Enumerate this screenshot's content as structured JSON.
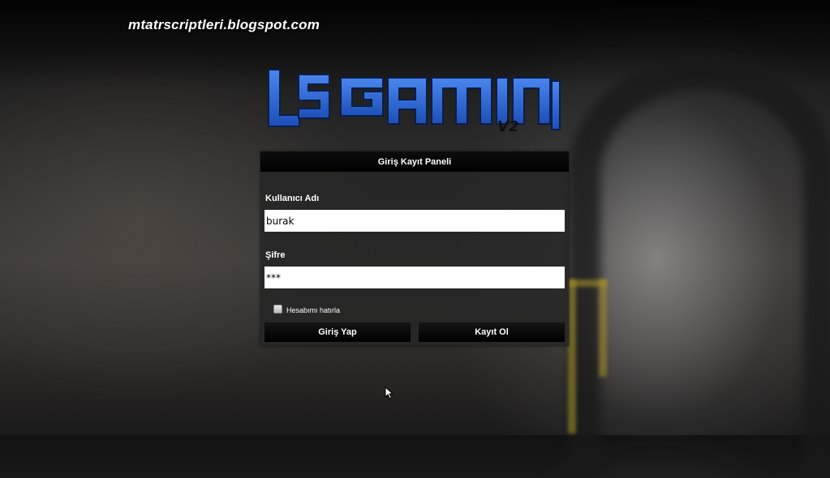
{
  "watermark": "mtatrscriptleri.blogspot.com",
  "logo": {
    "text": "LS Gaming",
    "version": "V2",
    "color": "#2f6ad8"
  },
  "panel": {
    "title": "Giriş Kayıt Paneli",
    "username_label": "Kullanıcı Adı",
    "username_value": "burak",
    "password_label": "Şifre",
    "password_value": "***",
    "remember_label": "Hesabımı hatırla",
    "remember_checked": false,
    "login_button": "Giriş Yap",
    "register_button": "Kayıt Ol"
  },
  "icons": {
    "cursor": "mouse-pointer-icon",
    "checkbox": "checkbox-icon"
  }
}
